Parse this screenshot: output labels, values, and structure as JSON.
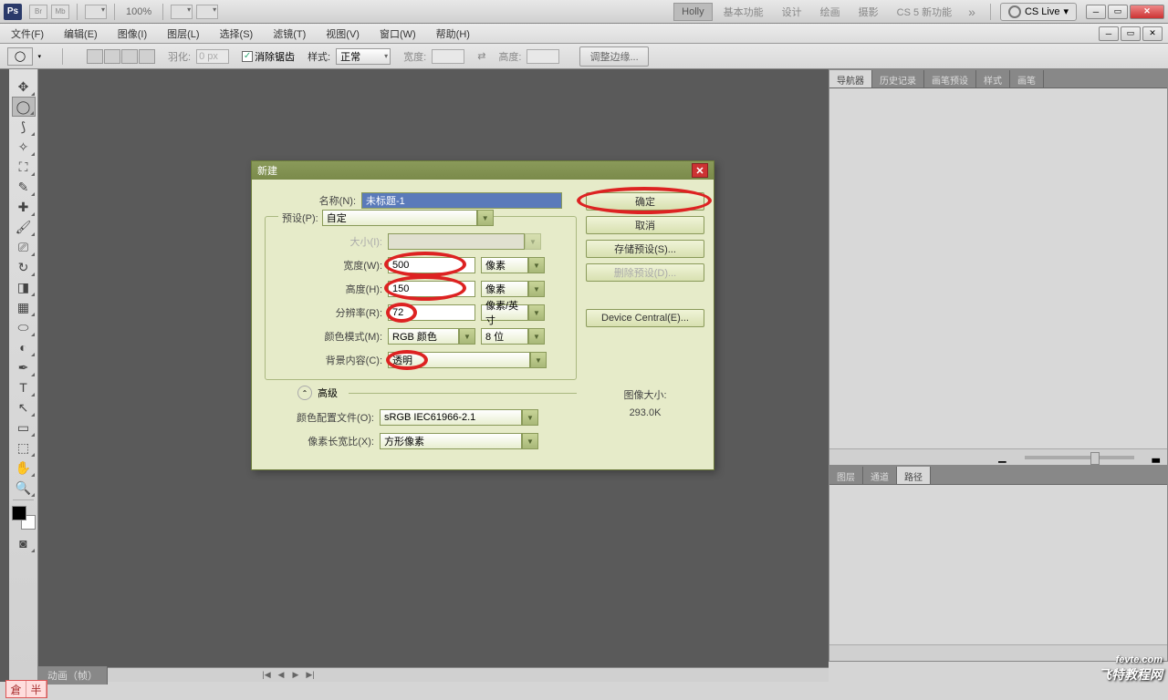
{
  "topbar": {
    "zoom": "100%",
    "cslive": "CS Live"
  },
  "workspaces": {
    "active": "Holly",
    "items": [
      "Holly",
      "基本功能",
      "设计",
      "绘画",
      "摄影",
      "CS 5 新功能"
    ]
  },
  "menu": {
    "file": "文件(F)",
    "edit": "编辑(E)",
    "image": "图像(I)",
    "layer": "图层(L)",
    "select": "选择(S)",
    "filter": "滤镜(T)",
    "view": "视图(V)",
    "window": "窗口(W)",
    "help": "帮助(H)"
  },
  "options": {
    "feather_label": "羽化:",
    "feather_value": "0 px",
    "antialias": "消除锯齿",
    "style_label": "样式:",
    "style_value": "正常",
    "width_label": "宽度:",
    "swap": "⇄",
    "height_label": "高度:",
    "refine": "调整边缘..."
  },
  "panels": {
    "navigator": "导航器",
    "history": "历史记录",
    "brushpreset": "画笔预设",
    "styles": "样式",
    "brushes": "画笔",
    "layers": "图层",
    "channels": "通道",
    "paths": "路径"
  },
  "timeline": {
    "label": "动画（帧）"
  },
  "dialog": {
    "title": "新建",
    "name_label": "名称(N):",
    "name_value": "未标题-1",
    "preset_label": "预设(P):",
    "preset_value": "自定",
    "size_label": "大小(I):",
    "width_label": "宽度(W):",
    "width_value": "500",
    "width_unit": "像素",
    "height_label": "高度(H):",
    "height_value": "150",
    "height_unit": "像素",
    "res_label": "分辨率(R):",
    "res_value": "72",
    "res_unit": "像素/英寸",
    "mode_label": "颜色模式(M):",
    "mode_value": "RGB 颜色",
    "bit_value": "8 位",
    "bg_label": "背景内容(C):",
    "bg_value": "透明",
    "advanced": "高级",
    "profile_label": "颜色配置文件(O):",
    "profile_value": "sRGB IEC61966-2.1",
    "aspect_label": "像素长宽比(X):",
    "aspect_value": "方形像素",
    "ok": "确定",
    "cancel": "取消",
    "save_preset": "存储预设(S)...",
    "delete_preset": "删除预设(D)...",
    "device_central": "Device Central(E)...",
    "size_info_label": "图像大小:",
    "size_info_value": "293.0K"
  },
  "watermark": {
    "main": "fevte.com",
    "sub": "飞特教程网"
  },
  "ime": {
    "a": "倉",
    "b": "半"
  }
}
